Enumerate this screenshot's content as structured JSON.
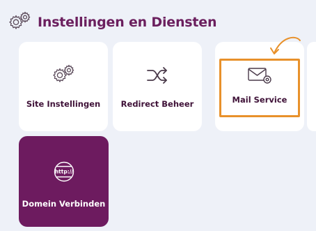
{
  "header": {
    "title": "Instellingen en Diensten",
    "icon": "gears-icon"
  },
  "tiles": [
    {
      "label": "Site Instellingen",
      "icon": "gears-icon"
    },
    {
      "label": "Redirect Beheer",
      "icon": "shuffle-icon"
    },
    {
      "label": "Mail Service",
      "icon": "mail-settings-icon",
      "highlighted": true
    },
    {
      "label": "Domein Verbinden",
      "icon": "http-globe-icon",
      "active": true
    }
  ],
  "colors": {
    "brand": "#6b1f5e",
    "highlight": "#e8912b",
    "background": "#eef1f8",
    "tile": "#ffffff"
  }
}
